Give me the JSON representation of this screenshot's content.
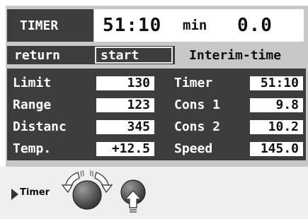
{
  "header": {
    "title": "TIMER",
    "time_value": "51:10",
    "time_unit": "min",
    "reading": "0.0"
  },
  "softkeys": {
    "return_label": "return",
    "start_label": "start",
    "interim_label": "Interim-time"
  },
  "fields": {
    "left": [
      {
        "label": "Limit",
        "value": "130"
      },
      {
        "label": "Range",
        "value": "123"
      },
      {
        "label": "Distanc",
        "value": "345"
      },
      {
        "label": "Temp.",
        "value": "+12.5"
      }
    ],
    "right": [
      {
        "label": "Timer",
        "value": "51:10"
      },
      {
        "label": "Cons 1",
        "value": "9.8"
      },
      {
        "label": "Cons 2",
        "value": "10.2"
      },
      {
        "label": "Speed",
        "value": "145.0"
      }
    ]
  },
  "controls": {
    "menu_label": "Timer",
    "menu_icon": "play-triangle-icon",
    "knob_icon": "rotary-knob-icon",
    "push_icon": "push-button-icon"
  },
  "colors": {
    "panel_dark": "#3d3d3d",
    "panel_grey": "#c8c8c8",
    "field_bg": "#ffffff"
  }
}
